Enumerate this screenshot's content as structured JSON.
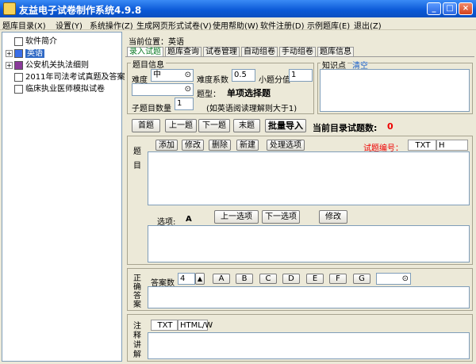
{
  "window": {
    "title": "友益电子试卷制作系统4.9.8",
    "min": "_",
    "max": "□",
    "close": "×"
  },
  "menu": [
    "题库目录(X)",
    "设置(Y)",
    "系统操作(Z)",
    "生成网页形式试卷(V)",
    "使用帮助(W)",
    "软件注册(D)",
    "示例题库(E)",
    "退出(Z)"
  ],
  "tree": [
    {
      "label": "软件简介"
    },
    {
      "label": "英语"
    },
    {
      "label": "公安机关执法细则"
    },
    {
      "label": "2011年司法考试真题及答案"
    },
    {
      "label": "临床执业医师模拟试卷"
    }
  ],
  "location": {
    "label": "当前位置：",
    "value": "英语"
  },
  "tabs": [
    "录入试题",
    "题库查询",
    "试卷管理",
    "自动组卷",
    "手动组卷",
    "题库信息"
  ],
  "question_info": {
    "title": "题目信息",
    "difficulty_label": "难度",
    "difficulty_value": "中",
    "coef_label": "难度系数",
    "coef_value": "0.5",
    "score_label": "小题分值",
    "score_value": "1",
    "type_label": "题型：",
    "type_value": "单项选择题",
    "sub_count_label": "子题目数量",
    "sub_count_value": "1",
    "sub_hint": "(如英语阅读理解则大于1)"
  },
  "knowledge": {
    "title": "知识点",
    "clear": "清空"
  },
  "nav": {
    "first": "首题",
    "prev": "上一题",
    "next": "下一题",
    "last": "末题",
    "batch": "批量导入",
    "count_label": "当前目录试题数:",
    "count_value": "0"
  },
  "question": {
    "side": [
      "题",
      "目"
    ],
    "add": "添加",
    "edit": "修改",
    "delete": "删除",
    "new": "新建",
    "options": "处理选项",
    "id_label": "试题编号：",
    "txt": "TXT",
    "h": "H"
  },
  "choices": {
    "label": "选项:",
    "current": "A",
    "prev": "上一选项",
    "next": "下一选项",
    "edit": "修改"
  },
  "answer": {
    "side": [
      "正",
      "确",
      "答",
      "案"
    ],
    "count_label": "答案数",
    "count_value": "4",
    "letters": [
      "A",
      "B",
      "C",
      "D",
      "E",
      "F",
      "G"
    ]
  },
  "explain": {
    "side": [
      "注",
      "释",
      "讲",
      "解"
    ],
    "txt": "TXT",
    "html": "HTML/W"
  }
}
